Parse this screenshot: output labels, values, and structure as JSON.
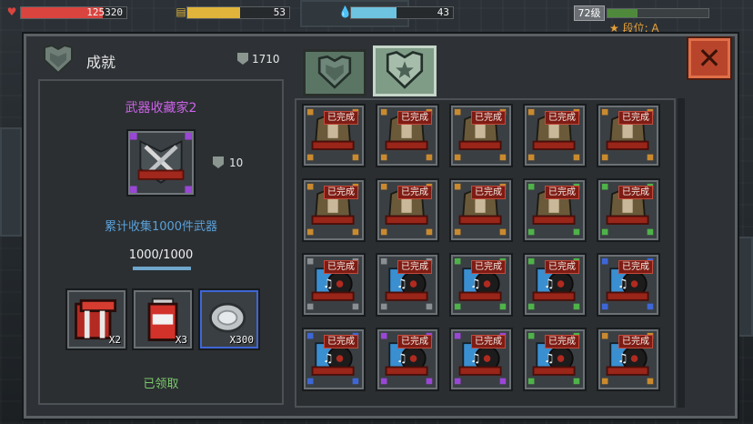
{
  "hud": {
    "hp_value": "125320",
    "hp_fill": 0.78,
    "gold_value": "53",
    "gold_fill": 0.52,
    "water_value": "43",
    "water_fill": 0.45,
    "level": "72级",
    "rank": "★ 段位: A",
    "colors": {
      "hp": "#d9443f",
      "gold": "#e0b43a",
      "water": "#6ec3e0"
    }
  },
  "dialog": {
    "title": "成就",
    "points": "1710",
    "close_icon": "close-icon"
  },
  "detail": {
    "name": "武器收藏家2",
    "reward_points": "10",
    "description": "累计收集1000件武器",
    "progress": "1000/1000",
    "progress_fill": 1.0,
    "rewards": [
      {
        "icon": "red-chest-icon",
        "qty": "X2"
      },
      {
        "icon": "soda-can-icon",
        "qty": "X3"
      },
      {
        "icon": "silver-coin-icon",
        "qty": "X300"
      }
    ],
    "status": "已领取"
  },
  "tabs": [
    {
      "icon": "shield-emblem-icon",
      "selected": false
    },
    {
      "icon": "star-shield-icon",
      "selected": true
    }
  ],
  "grid": {
    "done_label": "已完成",
    "cells": [
      {
        "type": "armor",
        "corner": "#c98a2f"
      },
      {
        "type": "armor",
        "corner": "#c98a2f"
      },
      {
        "type": "armor",
        "corner": "#c98a2f"
      },
      {
        "type": "armor",
        "corner": "#c98a2f"
      },
      {
        "type": "armor",
        "corner": "#c98a2f"
      },
      {
        "type": "armor",
        "corner": "#c98a2f"
      },
      {
        "type": "armor",
        "corner": "#c98a2f"
      },
      {
        "type": "armor",
        "corner": "#c98a2f"
      },
      {
        "type": "armor",
        "corner": "#4fb24a"
      },
      {
        "type": "armor",
        "corner": "#4fb24a"
      },
      {
        "type": "music",
        "corner": "#8a8f93"
      },
      {
        "type": "music",
        "corner": "#8a8f93"
      },
      {
        "type": "music",
        "corner": "#4fb24a"
      },
      {
        "type": "music",
        "corner": "#4fb24a"
      },
      {
        "type": "music",
        "corner": "#3e66d6"
      },
      {
        "type": "music",
        "corner": "#3e66d6"
      },
      {
        "type": "music",
        "corner": "#9a47d6"
      },
      {
        "type": "music",
        "corner": "#9a47d6"
      },
      {
        "type": "music",
        "corner": "#4fb24a"
      },
      {
        "type": "music",
        "corner": "#c98a2f"
      }
    ]
  }
}
